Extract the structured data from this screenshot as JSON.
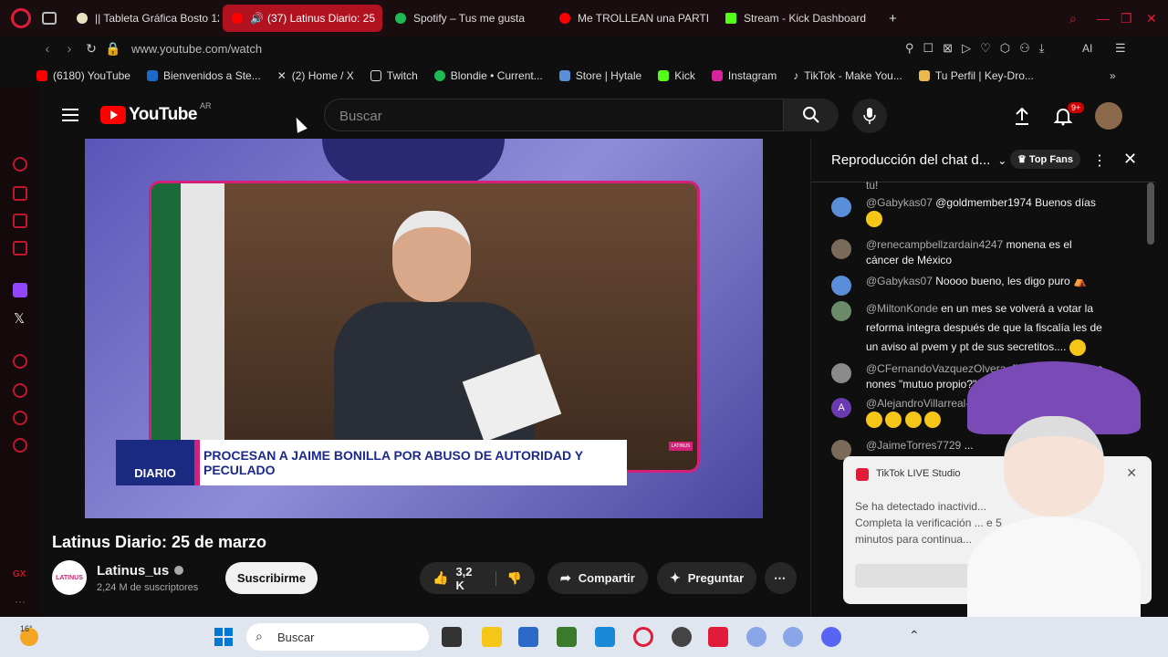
{
  "tabs": [
    {
      "label": "|| Tableta Gráfica Bosto 12",
      "color": "#e9e2c0",
      "active": false
    },
    {
      "label": "(37) Latinus Diario: 25",
      "color": "#ff0000",
      "active": true
    },
    {
      "label": "Spotify – Tus me gusta",
      "color": "#1db954",
      "active": false
    },
    {
      "label": "Me TROLLEAN una PARTI",
      "color": "#ff0000",
      "active": false
    },
    {
      "label": "Stream - Kick Dashboard",
      "color": "#53fc18",
      "active": false
    }
  ],
  "new_tab": "+",
  "address": {
    "url": "www.youtube.com/watch",
    "ai_label": "AI"
  },
  "bookmarks": [
    {
      "label": "(6180) YouTube",
      "color": "#ff0000"
    },
    {
      "label": "Bienvenidos a Ste...",
      "color": "#1b6ac9"
    },
    {
      "label": "(2) Home / X",
      "color": "#dddddd"
    },
    {
      "label": "Twitch",
      "color": "#dddddd"
    },
    {
      "label": "Blondie • Current...",
      "color": "#1db954"
    },
    {
      "label": "Store | Hytale",
      "color": "#5a8ed8"
    },
    {
      "label": "Kick",
      "color": "#53fc18"
    },
    {
      "label": "Instagram",
      "color": "#d6249f"
    },
    {
      "label": "TikTok - Make You...",
      "color": "#dddddd"
    },
    {
      "label": "Tu Perfil | Key-Dro...",
      "color": "#e9b949"
    }
  ],
  "youtube": {
    "logo_text": "YouTube",
    "region": "AR",
    "search_placeholder": "Buscar",
    "notification_count": "9+"
  },
  "video": {
    "lower_third_logo": "DIARIO",
    "lower_third_logo_small": "LATINUS",
    "headline": "PROCESAN A JAIME BONILLA POR ABUSO DE AUTORIDAD Y PECULADO",
    "title": "Latinus Diario: 25 de marzo",
    "channel": "Latinus_us",
    "channel_avatar_text": "LATINUS",
    "subscribers": "2,24 M de suscriptores",
    "subscribe_label": "Suscribirme",
    "likes": "3,2 K",
    "share_label": "Compartir",
    "ask_label": "Preguntar"
  },
  "chat": {
    "title": "Reproducción del chat d...",
    "top_fans": "Top Fans",
    "cut_text": "tu!",
    "messages": [
      {
        "author": "@Gabykas07",
        "text": "@goldmember1974 Buenos días",
        "color": "#5a8ed8"
      },
      {
        "author": "@renecampbellzardain4247",
        "text": "monena es el cáncer de México",
        "color": "#7a6a5a"
      },
      {
        "author": "@Gabykas07",
        "text": "Noooo bueno, les digo puro",
        "color": "#5a8ed8"
      },
      {
        "author": "@MiltonKonde",
        "text": "en un mes se volverá a votar la reforma integra   después de que la fiscalía les de un aviso al pvem y pt de sus secretitos....",
        "color": "#6a8a6a"
      },
      {
        "author": "@CFernandoVazquezOlvera",
        "text": "dijo ... propio\"? que nones \"mutuo propio?\" jgsj",
        "color": "#8a8a8a"
      },
      {
        "author": "@AlejandroVillarreal-...",
        "text": "ON",
        "color": "#6a3ab0",
        "initial": "A"
      },
      {
        "author": "@JaimeTorres7729",
        "text": "...",
        "color": "#7a6a5a"
      }
    ]
  },
  "toast": {
    "title": "TikTok LIVE Studio",
    "body": "Se ha detectado inactivid... Completa la verificación ... e 5 minutos para continua..."
  },
  "taskbar": {
    "temperature": "16°",
    "search_placeholder": "Buscar"
  }
}
